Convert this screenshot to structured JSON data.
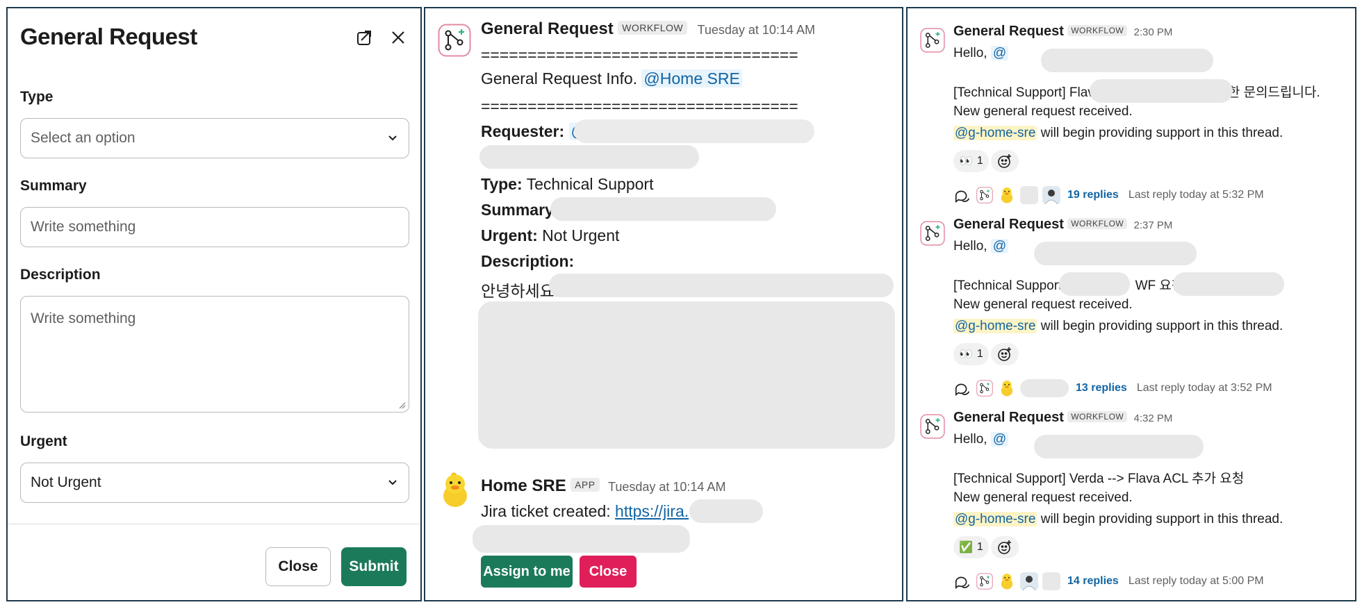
{
  "modal": {
    "title": "General Request",
    "type_label": "Type",
    "type_placeholder": "Select an option",
    "summary_label": "Summary",
    "summary_placeholder": "Write something",
    "description_label": "Description",
    "description_placeholder": "Write something",
    "urgent_label": "Urgent",
    "urgent_value": "Not Urgent",
    "close_label": "Close",
    "submit_label": "Submit"
  },
  "detail": {
    "sender": "General Request",
    "tag": "WORKFLOW",
    "timestamp": "Tuesday at 10:14 AM",
    "separator": "==================================",
    "info_text": "General Request Info.",
    "info_mention": "@Home SRE",
    "requester_label": "Requester:",
    "requester_mention": "@",
    "type_label": "Type:",
    "type_value": "Technical Support",
    "summary_label": "Summary:",
    "urgent_label": "Urgent:",
    "urgent_value": "Not Urgent",
    "description_label": "Description:",
    "description_start": "안녕하세요.",
    "bot_sender": "Home SRE",
    "bot_tag": "APP",
    "bot_timestamp": "Tuesday at 10:14 AM",
    "jira_text": "Jira ticket created:",
    "jira_link": "https://jira.",
    "assign_label": "Assign to me",
    "close_label": "Close"
  },
  "feed": {
    "new_request_text": "New general request received.",
    "support_mention": "@g-home-sre",
    "support_text": "will begin providing support in this thread.",
    "hello": "Hello,",
    "messages": [
      {
        "sender": "General Request",
        "tag": "WORKFLOW",
        "time": "2:30 PM",
        "mention": "@",
        "subject_a": "[Technical Support] Flava",
        "subject_b": "권한 문의드립니다.",
        "reaction_emoji": "👀",
        "reaction_count": "1",
        "replies": "19 replies",
        "last_reply": "Last reply today at 5:32 PM"
      },
      {
        "sender": "General Request",
        "tag": "WORKFLOW",
        "time": "2:37 PM",
        "mention": "@",
        "subject_a": "[Technical Support]",
        "subject_b": "WF 요청",
        "reaction_emoji": "👀",
        "reaction_count": "1",
        "replies": "13 replies",
        "last_reply": "Last reply today at 3:52 PM"
      },
      {
        "sender": "General Request",
        "tag": "WORKFLOW",
        "time": "4:32 PM",
        "mention": "@",
        "mention_end": ".",
        "subject_a": "[Technical Support] Verda --> Flava ACL 추가 요청",
        "subject_b": "",
        "reaction_emoji": "✅",
        "reaction_count": "1",
        "replies": "14 replies",
        "last_reply": "Last reply today at 5:00 PM"
      }
    ]
  },
  "colors": {
    "primary_green": "#1b7a5a",
    "danger_red": "#e01e5a",
    "link_blue": "#1264a3",
    "mention_bg": "#e8f4fb",
    "group_mention_bg": "#fdf4c6"
  },
  "icons": [
    "new-window-icon",
    "close-icon",
    "chevron-down-icon",
    "workflow-icon",
    "duck-icon",
    "thread-icon",
    "add-reaction-icon"
  ]
}
